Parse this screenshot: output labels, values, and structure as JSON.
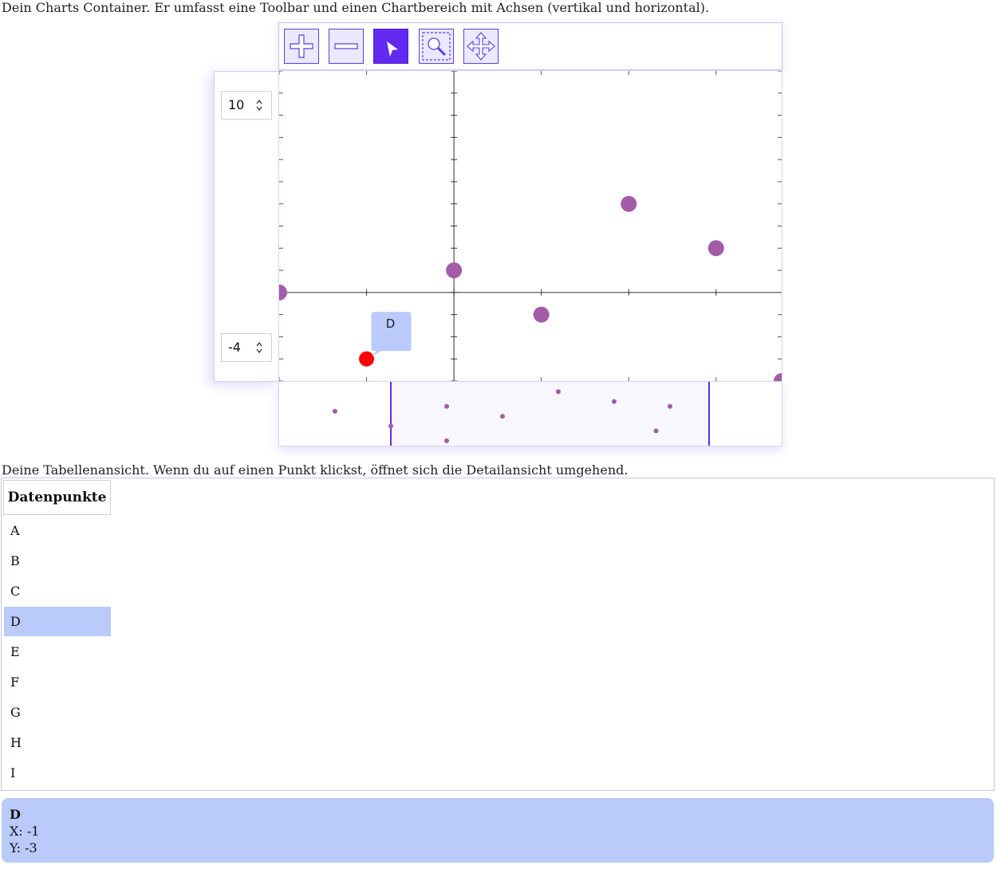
{
  "captions": {
    "chart": "Dein Charts Container. Er umfasst eine Toolbar und einen Chartbereich mit Achsen (vertikal und horizontal).",
    "table": "Deine Tabellenansicht. Wenn du auf einen Punkt klickst, öffnet sich die Detailansicht umgehend."
  },
  "toolbar": {
    "buttons": [
      {
        "name": "zoom-in",
        "icon": "plus-icon",
        "active": false
      },
      {
        "name": "zoom-out",
        "icon": "minus-icon",
        "active": false
      },
      {
        "name": "select",
        "icon": "cursor-arrow-icon",
        "active": true
      },
      {
        "name": "zoom-box",
        "icon": "magnifier-box-icon",
        "active": false
      },
      {
        "name": "pan",
        "icon": "move-arrows-icon",
        "active": false
      }
    ]
  },
  "y_range": {
    "max": "10",
    "min": "-4"
  },
  "colors": {
    "point": "#a25ca8",
    "selected": "#ff0000",
    "accent": "#6229f0",
    "highlight": "#b9cafb"
  },
  "chart_data": {
    "type": "scatter",
    "xlim": [
      -2,
      3.75
    ],
    "ylim": [
      -4,
      10
    ],
    "grid": false,
    "points": [
      {
        "name": "A",
        "x": -2,
        "y": 0
      },
      {
        "name": "B",
        "x": 0,
        "y": 1
      },
      {
        "name": "C",
        "x": 1,
        "y": -1
      },
      {
        "name": "D",
        "x": -1,
        "y": -3
      },
      {
        "name": "E",
        "x": 2,
        "y": 4
      },
      {
        "name": "F",
        "x": 3,
        "y": 2
      },
      {
        "name": "G",
        "x": 3.75,
        "y": -4
      },
      {
        "name": "H",
        "x": 0,
        "y": -6
      },
      {
        "name": "I",
        "x": 4,
        "y": 1
      }
    ],
    "selected": "D",
    "navigator": {
      "xlim": [
        -3,
        6
      ],
      "window": [
        -1,
        4.7
      ]
    }
  },
  "table": {
    "header": "Datenpunkte",
    "rows": [
      "A",
      "B",
      "C",
      "D",
      "E",
      "F",
      "G",
      "H",
      "I"
    ],
    "selected_index": 3
  },
  "detail": {
    "name": "D",
    "x_text": "X: -1",
    "y_text": "Y: -3"
  }
}
